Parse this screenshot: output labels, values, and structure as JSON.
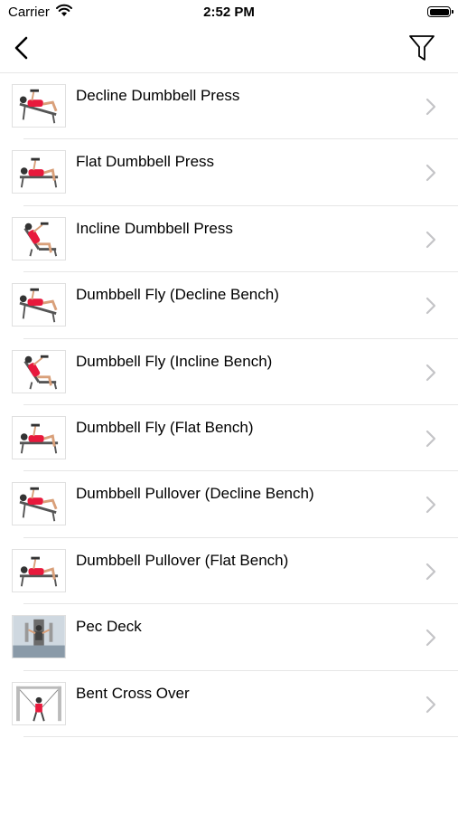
{
  "status_bar": {
    "carrier": "Carrier",
    "time": "2:52 PM"
  },
  "nav": {
    "back_icon": "chevron-left-icon",
    "filter_icon": "filter-funnel-icon"
  },
  "exercises": [
    {
      "name": "Decline Dumbbell Press",
      "thumb": "decline-bench-figure"
    },
    {
      "name": "Flat Dumbbell Press",
      "thumb": "flat-bench-figure"
    },
    {
      "name": "Incline Dumbbell Press",
      "thumb": "incline-bench-figure"
    },
    {
      "name": "Dumbbell Fly (Decline Bench)",
      "thumb": "decline-bench-figure"
    },
    {
      "name": "Dumbbell Fly (Incline Bench)",
      "thumb": "incline-bench-figure"
    },
    {
      "name": "Dumbbell Fly (Flat Bench)",
      "thumb": "flat-bench-figure"
    },
    {
      "name": "Dumbbell Pullover (Decline Bench)",
      "thumb": "decline-bench-figure"
    },
    {
      "name": "Dumbbell Pullover (Flat Bench)",
      "thumb": "flat-bench-figure"
    },
    {
      "name": "Pec Deck",
      "thumb": "pec-deck-machine"
    },
    {
      "name": "Bent Cross Over",
      "thumb": "cable-machine"
    }
  ],
  "colors": {
    "accent_figure": "#e8193c",
    "separator": "#e6e6e6",
    "chevron": "#c4c4c7"
  }
}
